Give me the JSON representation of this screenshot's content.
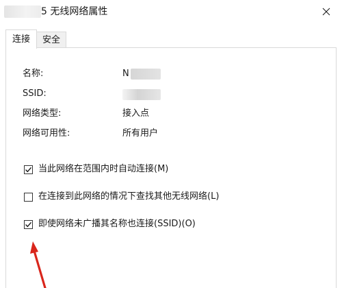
{
  "window": {
    "title": "5 无线网络属性"
  },
  "tabs": [
    {
      "label": "连接",
      "active": true
    },
    {
      "label": "安全",
      "active": false
    }
  ],
  "properties": [
    {
      "label": "名称:",
      "value": "N"
    },
    {
      "label": "SSID:",
      "value": ""
    },
    {
      "label": "网络类型:",
      "value": "接入点"
    },
    {
      "label": "网络可用性:",
      "value": "所有用户"
    }
  ],
  "options": [
    {
      "label": "当此网络在范围内时自动连接(M)",
      "checked": true
    },
    {
      "label": "在连接到此网络的情况下查找其他无线网络(L)",
      "checked": false
    },
    {
      "label": "即使网络未广播其名称也连接(SSID)(O)",
      "checked": true
    }
  ],
  "icons": {
    "close": "close-icon",
    "check": "checkmark-icon",
    "annotation": "red-arrow-icon"
  },
  "colors": {
    "annotation_red": "#d9261c",
    "border": "#d9d9d9",
    "tab_inactive_bg": "#f0f0f0"
  }
}
